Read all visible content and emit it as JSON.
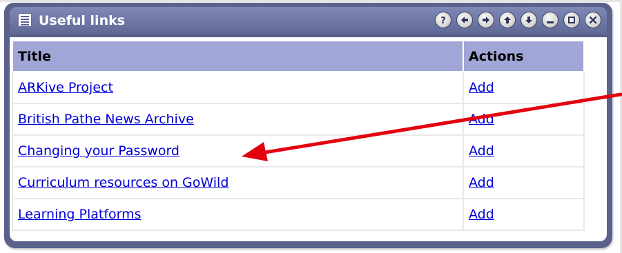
{
  "portlet": {
    "title": "Useful links",
    "controls": [
      "help-icon",
      "arrow-left-icon",
      "arrow-right-icon",
      "arrow-up-icon",
      "arrow-down-icon",
      "minimize-icon",
      "maximize-icon",
      "close-icon"
    ]
  },
  "table": {
    "headers": {
      "title": "Title",
      "actions": "Actions"
    },
    "rows": [
      {
        "title": "ARKive Project",
        "action": "Add"
      },
      {
        "title": "British Pathe News Archive",
        "action": "Add"
      },
      {
        "title": "Changing your Password",
        "action": "Add"
      },
      {
        "title": "Curriculum resources on GoWild",
        "action": "Add"
      },
      {
        "title": "Learning Platforms",
        "action": "Add"
      }
    ]
  },
  "colors": {
    "frame": "#5a618a",
    "header_bg": "#a0a6d6",
    "link": "#0000d4",
    "annotation_arrow": "#e3000f"
  }
}
